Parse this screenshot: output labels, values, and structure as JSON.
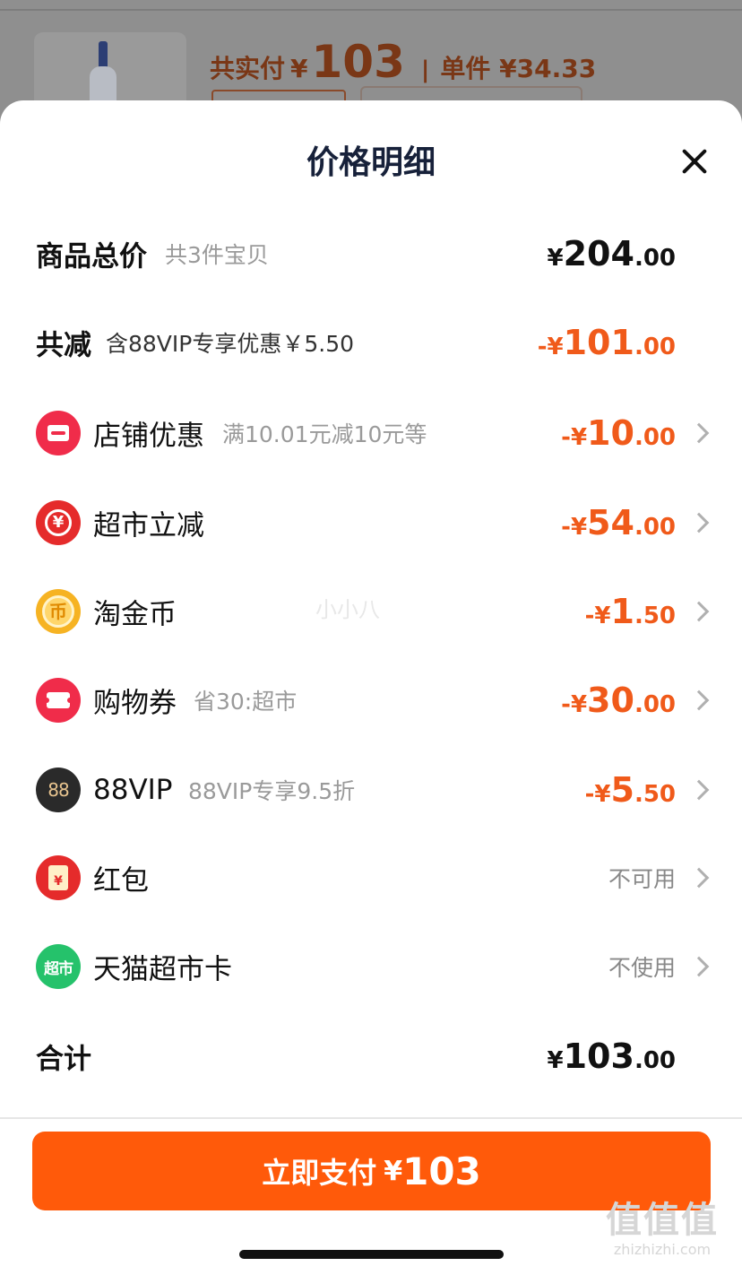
{
  "background": {
    "summary_label": "共实付",
    "summary_yen": "¥",
    "summary_amount": "103",
    "separator": "|",
    "unit_price": "单件 ¥34.33"
  },
  "sheet": {
    "title": "价格明细",
    "close_icon": "close-icon"
  },
  "rows": {
    "total": {
      "label": "商品总价",
      "sub": "共3件宝贝",
      "yen": "¥",
      "int": "204",
      "dec": ".00"
    },
    "discount": {
      "label": "共减",
      "sub": "含88VIP专享优惠￥5.50",
      "yen": "-¥",
      "int": "101",
      "dec": ".00"
    },
    "store": {
      "icon": "store-icon",
      "label": "店铺优惠",
      "sub": "满10.01元减10元等",
      "yen": "-¥",
      "int": "10",
      "dec": ".00"
    },
    "supermarket": {
      "icon": "yen-coupon-icon",
      "label": "超市立减",
      "sub": "",
      "yen": "-¥",
      "int": "54",
      "dec": ".00"
    },
    "coin": {
      "icon": "coin-icon",
      "glyph": "币",
      "label": "淘金币",
      "sub": "",
      "yen": "-¥",
      "int": "1",
      "dec": ".50"
    },
    "voucher": {
      "icon": "ticket-icon",
      "label": "购物券",
      "sub": "省30:超市",
      "yen": "-¥",
      "int": "30",
      "dec": ".00"
    },
    "vip": {
      "icon": "vip-88-icon",
      "glyph": "88",
      "label": "88VIP",
      "sub": "88VIP专享9.5折",
      "yen": "-¥",
      "int": "5",
      "dec": ".50"
    },
    "redpacket": {
      "icon": "red-envelope-icon",
      "glyph": "¥",
      "label": "红包",
      "status": "不可用"
    },
    "card": {
      "icon": "supermarket-card-icon",
      "glyph": "超市",
      "label": "天猫超市卡",
      "status": "不使用"
    },
    "sum": {
      "label": "合计",
      "yen": "¥",
      "int": "103",
      "dec": ".00"
    }
  },
  "watermark_mid": "小小八",
  "pay_button": {
    "label": "立即支付",
    "yen": "¥",
    "amount": "103"
  },
  "corner_watermark": {
    "main": "值值值",
    "sub": "zhizhizhi.com"
  },
  "colors": {
    "accent": "#ff5a0a",
    "discount_text": "#f05a1a",
    "title": "#17213a"
  }
}
